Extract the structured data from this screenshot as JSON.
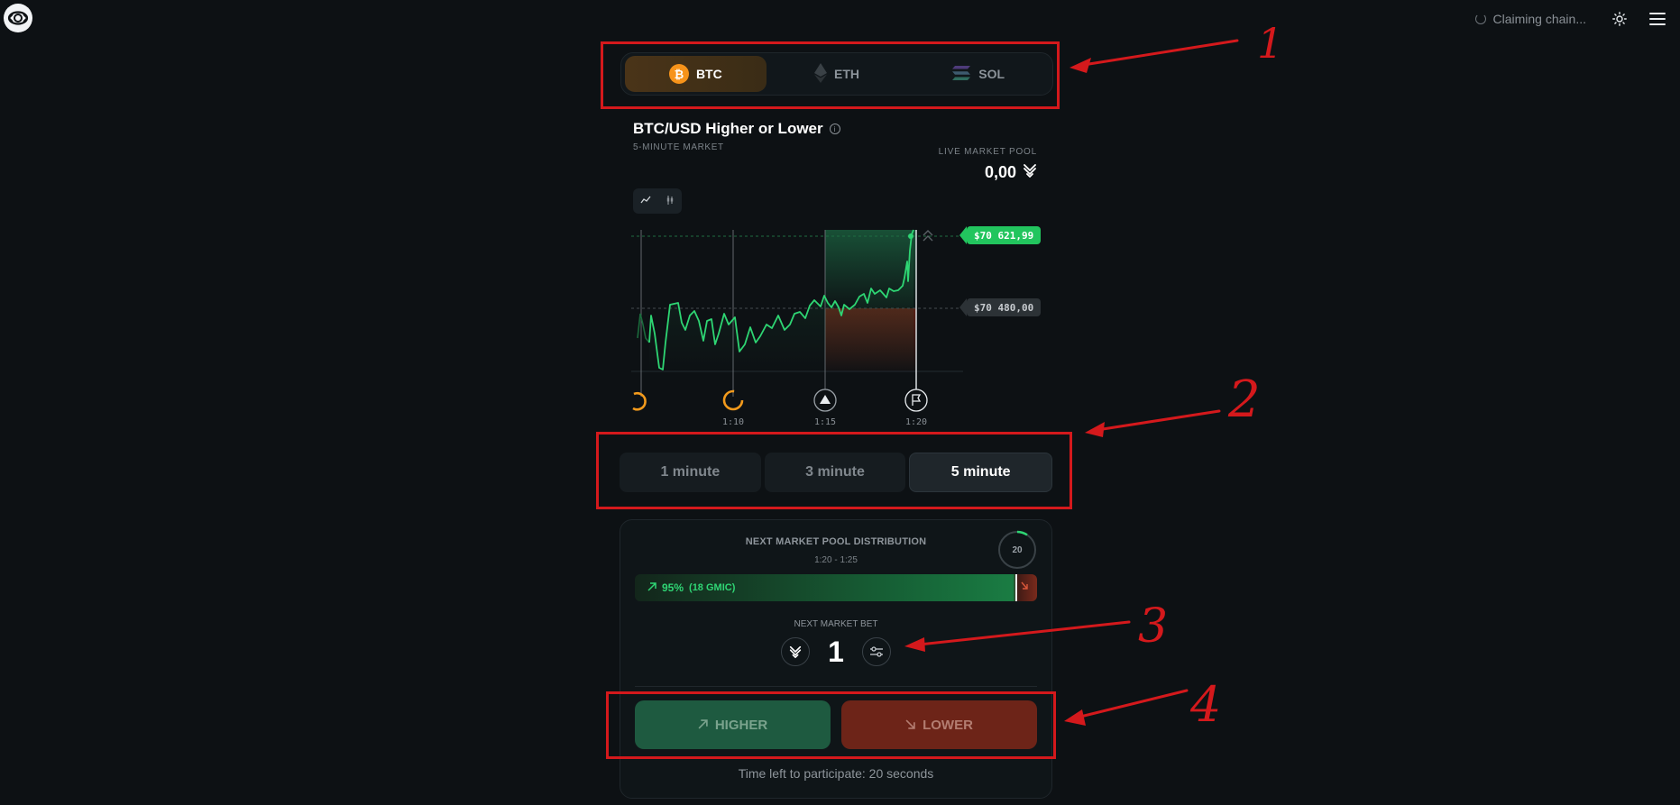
{
  "header": {
    "status_text": "Claiming chain...",
    "icons": [
      "logo-icon",
      "spinner-icon",
      "sun-icon",
      "menu-icon"
    ]
  },
  "coins": [
    {
      "label": "BTC",
      "icon": "bitcoin-icon",
      "active": true
    },
    {
      "label": "ETH",
      "icon": "ethereum-icon",
      "active": false
    },
    {
      "label": "SOL",
      "icon": "solana-icon",
      "active": false
    }
  ],
  "market": {
    "title": "BTC/USD Higher or Lower",
    "subtitle": "5-MINUTE MARKET",
    "pool_label": "LIVE MARKET POOL",
    "pool_value": "0,00"
  },
  "chart_data": {
    "type": "line",
    "current_price_label": "$70 621,99",
    "reference_price_label": "$70 480,00",
    "x_ticks": [
      "1:10",
      "1:15",
      "1:20"
    ]
  },
  "durations": [
    {
      "label": "1 minute",
      "active": false
    },
    {
      "label": "3 minute",
      "active": false
    },
    {
      "label": "5 minute",
      "active": true
    }
  ],
  "panel": {
    "distribution_title": "NEXT MARKET POOL DISTRIBUTION",
    "distribution_range": "1:20 - 1:25",
    "timer_value": "20",
    "higher_percent": "95%",
    "higher_amount": "(18 GMIC)",
    "bet_label": "NEXT MARKET BET",
    "bet_value": "1",
    "higher_label": "HIGHER",
    "lower_label": "LOWER",
    "time_left": "Time left to participate: 20 seconds"
  },
  "annotations": [
    "1",
    "2",
    "3",
    "4"
  ],
  "colors": {
    "background": "#0d1114",
    "up": "#22c55e",
    "down": "#7a2a1c",
    "annotation": "#d4191c",
    "btc": "#f7931a"
  }
}
